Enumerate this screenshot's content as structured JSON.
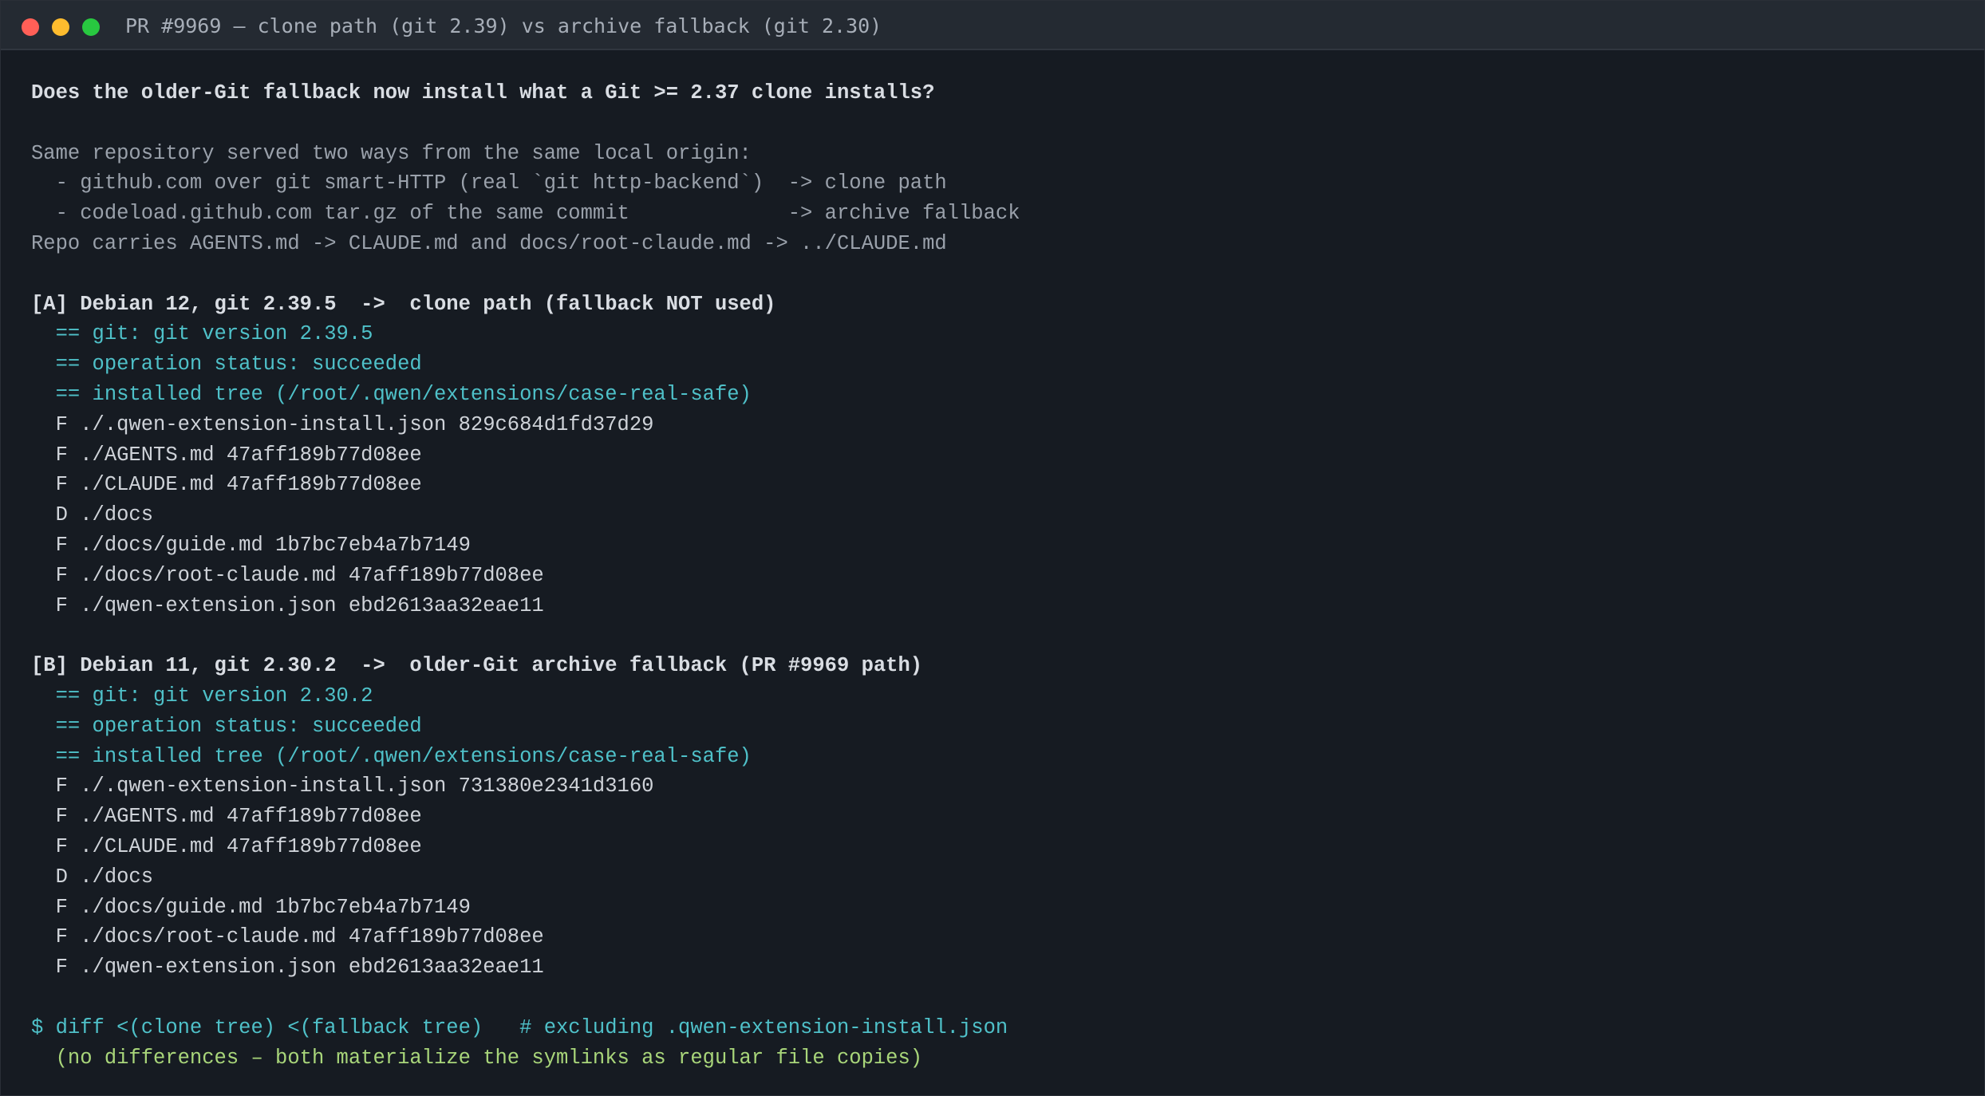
{
  "window": {
    "title": "PR #9969 – clone path (git 2.39) vs archive fallback (git 2.30)"
  },
  "terminal": {
    "question": "Does the older-Git fallback now install what a Git >= 2.37 clone installs?",
    "intro": [
      "Same repository served two ways from the same local origin:",
      "  - github.com over git smart-HTTP (real `git http-backend`)  -> clone path",
      "  - codeload.github.com tar.gz of the same commit             -> archive fallback",
      "Repo carries AGENTS.md -> CLAUDE.md and docs/root-claude.md -> ../CLAUDE.md"
    ],
    "section_a": {
      "header": "[A] Debian 12, git 2.39.5  ->  clone path (fallback NOT used)",
      "info": [
        "  == git: git version 2.39.5",
        "  == operation status: succeeded",
        "  == installed tree (/root/.qwen/extensions/case-real-safe)"
      ],
      "files": [
        "  F ./.qwen-extension-install.json 829c684d1fd37d29",
        "  F ./AGENTS.md 47aff189b77d08ee",
        "  F ./CLAUDE.md 47aff189b77d08ee",
        "  D ./docs",
        "  F ./docs/guide.md 1b7bc7eb4a7b7149",
        "  F ./docs/root-claude.md 47aff189b77d08ee",
        "  F ./qwen-extension.json ebd2613aa32eae11"
      ]
    },
    "section_b": {
      "header": "[B] Debian 11, git 2.30.2  ->  older-Git archive fallback (PR #9969 path)",
      "info": [
        "  == git: git version 2.30.2",
        "  == operation status: succeeded",
        "  == installed tree (/root/.qwen/extensions/case-real-safe)"
      ],
      "files": [
        "  F ./.qwen-extension-install.json 731380e2341d3160",
        "  F ./AGENTS.md 47aff189b77d08ee",
        "  F ./CLAUDE.md 47aff189b77d08ee",
        "  D ./docs",
        "  F ./docs/guide.md 1b7bc7eb4a7b7149",
        "  F ./docs/root-claude.md 47aff189b77d08ee",
        "  F ./qwen-extension.json ebd2613aa32eae11"
      ]
    },
    "diff_command": "$ diff <(clone tree) <(fallback tree)   # excluding .qwen-extension-install.json",
    "diff_result": "  (no differences – both materialize the symlinks as regular file copies)"
  }
}
